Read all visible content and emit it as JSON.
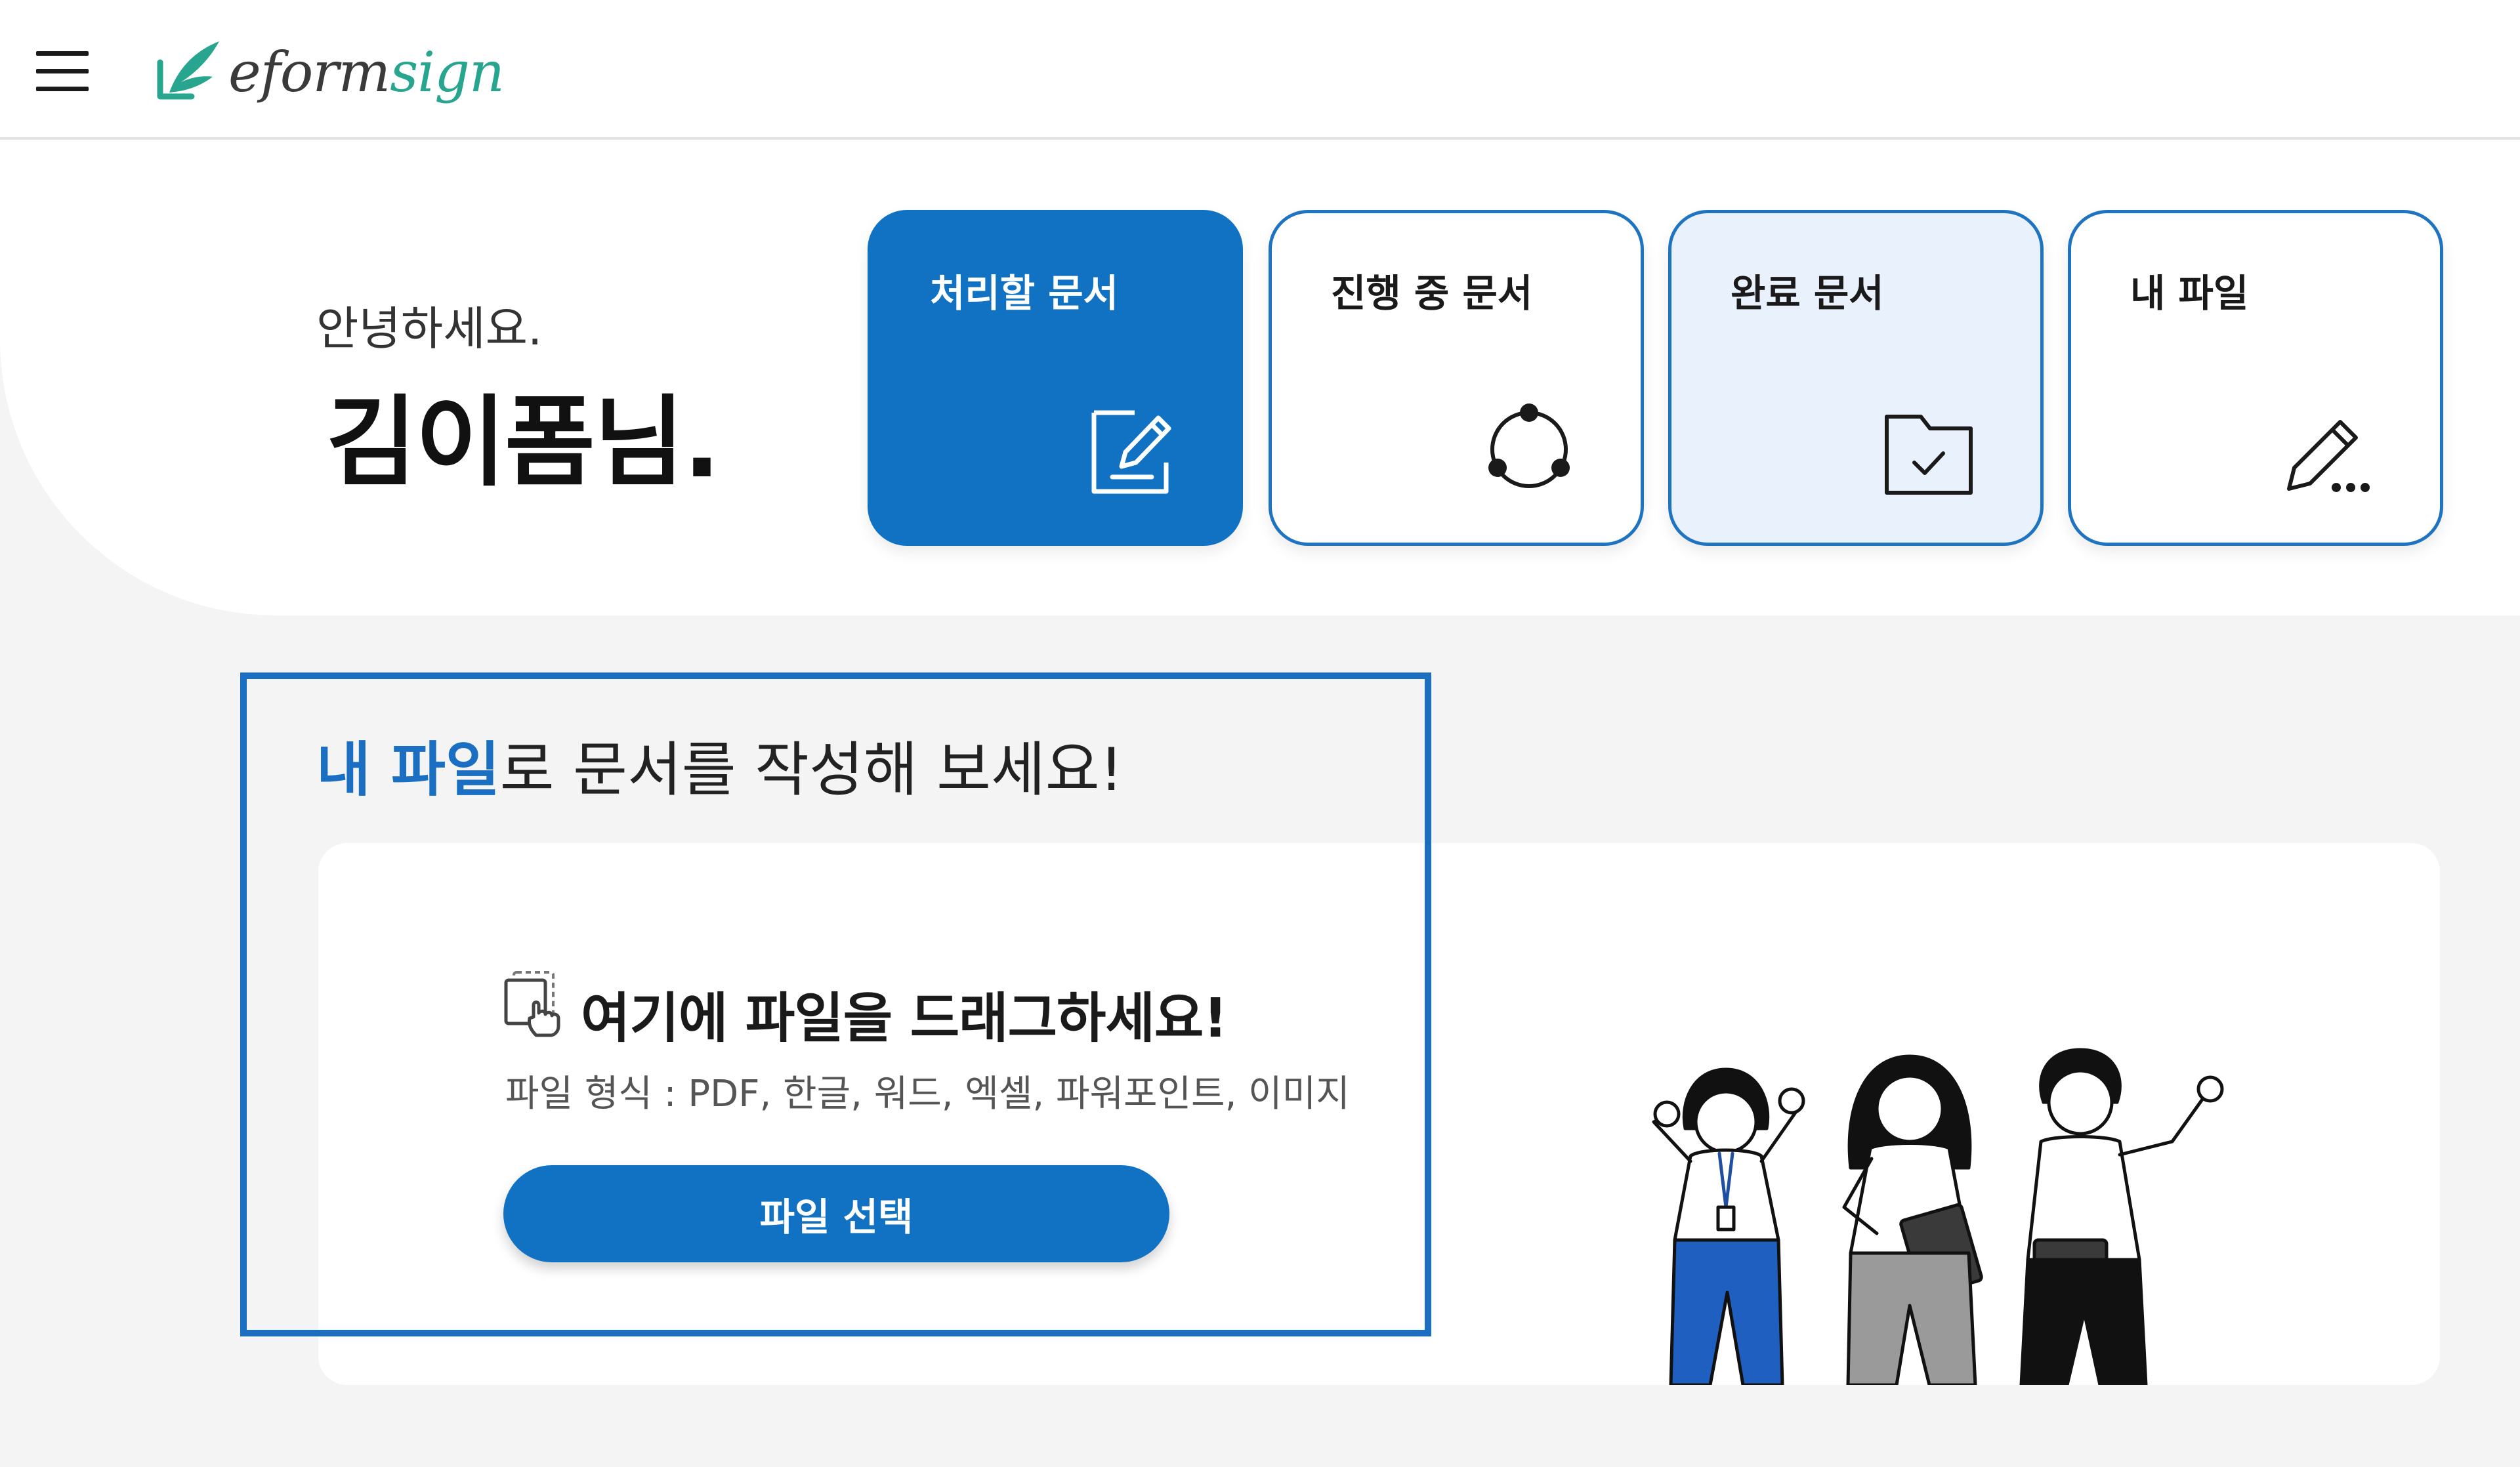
{
  "header": {
    "logo_mark": "e",
    "logo_text_1": "form",
    "logo_text_2": "sign"
  },
  "greeting": {
    "hello": "안녕하세요.",
    "name": "김이폼님."
  },
  "cards": [
    {
      "label": "처리할 문서",
      "icon": "document-edit-icon"
    },
    {
      "label": "진행 중 문서",
      "icon": "cycle-icon"
    },
    {
      "label": "완료 문서",
      "icon": "folder-check-icon"
    },
    {
      "label": "내 파일",
      "icon": "pencil-more-icon"
    }
  ],
  "section": {
    "title_highlight": "내 파일",
    "title_rest": "로 문서를 작성해 보세요!"
  },
  "dropzone": {
    "title": "여기에 파일을 드래그하세요!",
    "formats": "파일 형식 : PDF, 한글, 워드, 엑셀, 파워포인트, 이미지",
    "button_label": "파일 선택",
    "icon": "drag-file-icon"
  },
  "colors": {
    "primary": "#1172c4",
    "brand_green": "#27a58e",
    "done_card_bg": "#e9f2fc",
    "highlight_border": "#1a6fc2"
  }
}
